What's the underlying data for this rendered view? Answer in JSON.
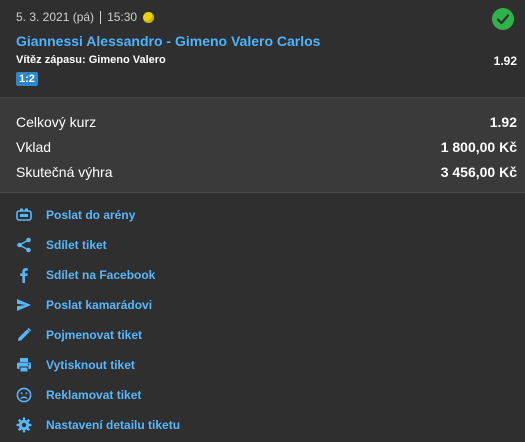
{
  "match": {
    "date": "5. 3. 2021 (pá)",
    "time": "15:30",
    "title": "Giannessi Alessandro - Gimeno Valero Carlos",
    "bet_label": "Vítěz zápasu: Gimeno Valero",
    "odds": "1.92",
    "score": "1:2",
    "status_icon": "check-circle-icon",
    "sport_icon": "tennis-ball-icon"
  },
  "summary": {
    "total_odds_label": "Celkový kurz",
    "total_odds_value": "1.92",
    "stake_label": "Vklad",
    "stake_value": "1 800,00 Kč",
    "win_label": "Skutečná výhra",
    "win_value": "3 456,00 Kč"
  },
  "actions": [
    {
      "label": "Poslat do arény",
      "icon": "arena-icon"
    },
    {
      "label": "Sdílet tiket",
      "icon": "share-icon"
    },
    {
      "label": "Sdílet na Facebook",
      "icon": "facebook-icon"
    },
    {
      "label": "Poslat kamarádovi",
      "icon": "send-icon"
    },
    {
      "label": "Pojmenovat tiket",
      "icon": "pencil-icon"
    },
    {
      "label": "Vytisknout tiket",
      "icon": "printer-icon"
    },
    {
      "label": "Reklamovat tiket",
      "icon": "sad-face-icon"
    },
    {
      "label": "Nastavení detailu tiketu",
      "icon": "gear-icon"
    }
  ],
  "colors": {
    "accent_blue": "#56b7ff",
    "success_green": "#2fb24a",
    "background": "#2f2f2f"
  }
}
